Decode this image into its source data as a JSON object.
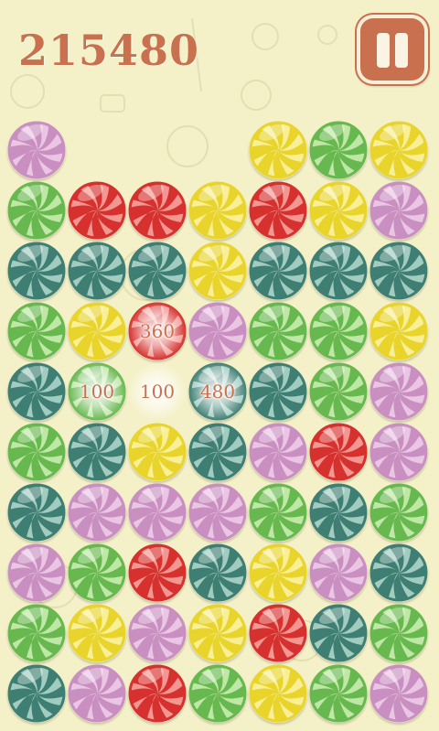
{
  "hud": {
    "score": "215480",
    "pause_icon": "pause-icon"
  },
  "palette": {
    "background": "#f4f1c9",
    "accent": "#c9704f",
    "purple": [
      "#c98fc0",
      "#f0d0ea"
    ],
    "green": [
      "#67b84f",
      "#cfeeb4"
    ],
    "red": [
      "#d6312e",
      "#f7a9a2"
    ],
    "yellow": [
      "#e8d42b",
      "#fbf3a9"
    ],
    "teal": [
      "#3f7f73",
      "#b5d9cf"
    ]
  },
  "board": {
    "columns": 7,
    "rows": 10,
    "grid": [
      [
        "purple",
        null,
        null,
        null,
        "yellow",
        "green",
        "yellow"
      ],
      [
        "green",
        "red",
        "red",
        "yellow",
        "red",
        "yellow",
        "purple"
      ],
      [
        "teal",
        "teal",
        "teal",
        "yellow",
        "teal",
        "teal",
        "teal"
      ],
      [
        "green",
        "yellow",
        "red",
        "purple",
        "green",
        "green",
        "yellow"
      ],
      [
        "teal",
        "green",
        null,
        "teal",
        "teal",
        "green",
        "purple"
      ],
      [
        "green",
        "teal",
        "yellow",
        "teal",
        "purple",
        "red",
        "purple"
      ],
      [
        "teal",
        "purple",
        "purple",
        "purple",
        "green",
        "teal",
        "green"
      ],
      [
        "purple",
        "green",
        "red",
        "teal",
        "yellow",
        "purple",
        "teal"
      ],
      [
        "green",
        "yellow",
        "purple",
        "yellow",
        "red",
        "teal",
        "green"
      ],
      [
        "teal",
        "purple",
        "red",
        "green",
        "yellow",
        "green",
        "purple"
      ]
    ],
    "popups": [
      {
        "text": "360",
        "row": 3,
        "col": 2
      },
      {
        "text": "100",
        "row": 4,
        "col": 1
      },
      {
        "text": "100",
        "row": 4,
        "col": 2
      },
      {
        "text": "480",
        "row": 4,
        "col": 3
      }
    ]
  }
}
